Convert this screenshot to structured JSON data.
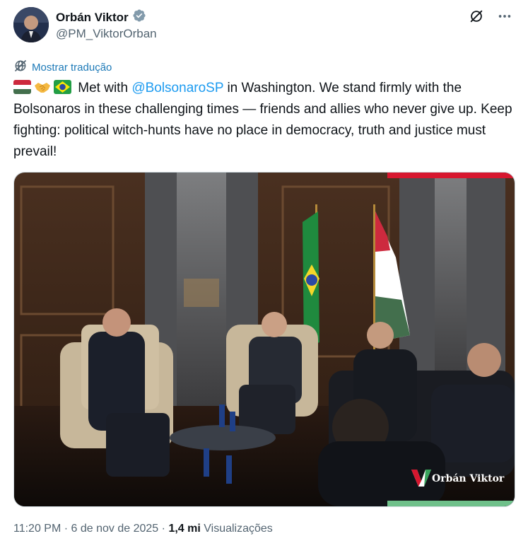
{
  "author": {
    "name": "Orbán Viktor",
    "handle": "@PM_ViktorOrban",
    "verified": true
  },
  "actions": {
    "grok_icon": "grok-icon",
    "more_icon": "more-icon"
  },
  "translate_label": "Mostrar tradução",
  "tweet": {
    "emojis": [
      "hungary-flag",
      "handshake",
      "brazil-flag"
    ],
    "text_before": "Met with ",
    "mention": "@BolsonaroSP",
    "text_after": " in Washington. We stand firmly with the Bolsonaros in these challenging times — friends and allies who never give up. Keep fighting: political witch-hunts have no place in democracy, truth and justice must prevail!"
  },
  "media": {
    "watermark": "Orbán Viktor"
  },
  "meta": {
    "time": "11:20 PM",
    "separator": "·",
    "date": "6 de nov de 2025",
    "views_count": "1,4 mi",
    "views_label": "Visualizações"
  },
  "colors": {
    "link": "#1d9bf0",
    "verified": "#829aab",
    "secondary_text": "#536471"
  }
}
